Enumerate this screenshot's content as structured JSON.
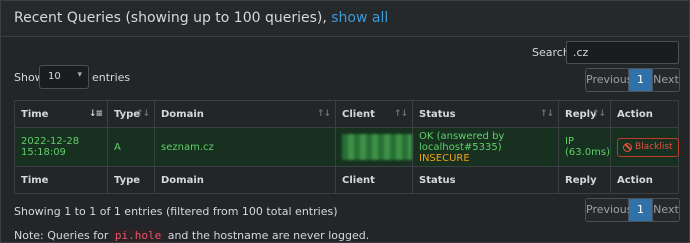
{
  "header": {
    "title": "Recent Queries (showing up to 100 queries), ",
    "show_all_link": "show all"
  },
  "search": {
    "label": "Search:",
    "value": ".cz"
  },
  "length": {
    "show_label": "Show",
    "selected": "10",
    "entries_label": "entries"
  },
  "pagination": {
    "previous": "Previous",
    "current_page": "1",
    "next": "Next"
  },
  "table": {
    "columns": [
      "Time",
      "Type",
      "Domain",
      "Client",
      "Status",
      "Reply",
      "Action"
    ],
    "rows": [
      {
        "time": "2022-12-28 15:18:09",
        "type": "A",
        "domain": "seznam.cz",
        "client": "",
        "status_line1": "OK (answered by localhost#5335)",
        "status_line2": "INSECURE",
        "reply_line1": "IP",
        "reply_line2": "(63.0ms)",
        "action": "Blacklist"
      }
    ]
  },
  "footer": {
    "info": "Showing 1 to 1 of 1 entries (filtered from 100 total entries)",
    "note_prefix": "Note: Queries for ",
    "note_code": "pi.hole",
    "note_suffix": " and the hostname are never logged."
  },
  "colors": {
    "row_bg": "#17301f",
    "row_text": "#5fd068",
    "insecure": "#f0a018",
    "link": "#3c9ad8",
    "page_active": "#3071a9",
    "blacklist": "#e55040"
  }
}
